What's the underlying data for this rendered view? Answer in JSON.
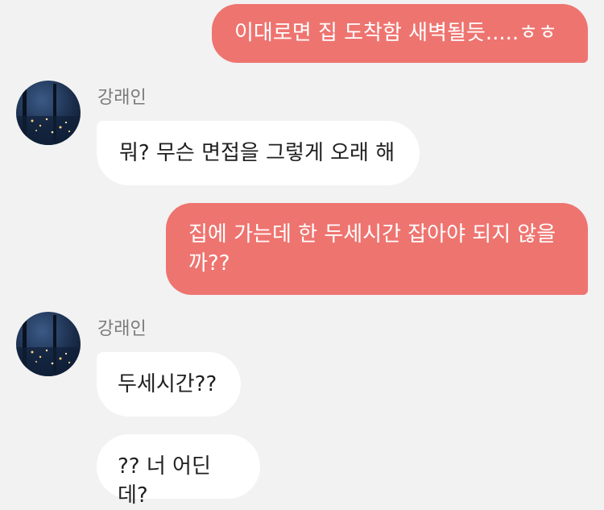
{
  "messages": [
    {
      "side": "out",
      "text": "이대로면 집 도착함 새벽될듯.....ㅎㅎ"
    },
    {
      "side": "in",
      "sender": "강래인",
      "text": "뭐? 무슨 면접을 그렇게 오래 해"
    },
    {
      "side": "out",
      "lines": [
        "집에 가는데 한 두세시간 잡아야 되지 않을",
        "까??"
      ]
    },
    {
      "side": "in",
      "sender": "강래인",
      "text": "두세시간??"
    },
    {
      "side": "in",
      "text": "?? 너 어딘데?"
    }
  ],
  "colors": {
    "background": "#f2f2f2",
    "outgoing_bubble": "#ee7470",
    "incoming_bubble": "#ffffff",
    "sender_name": "#7a7a7a"
  }
}
